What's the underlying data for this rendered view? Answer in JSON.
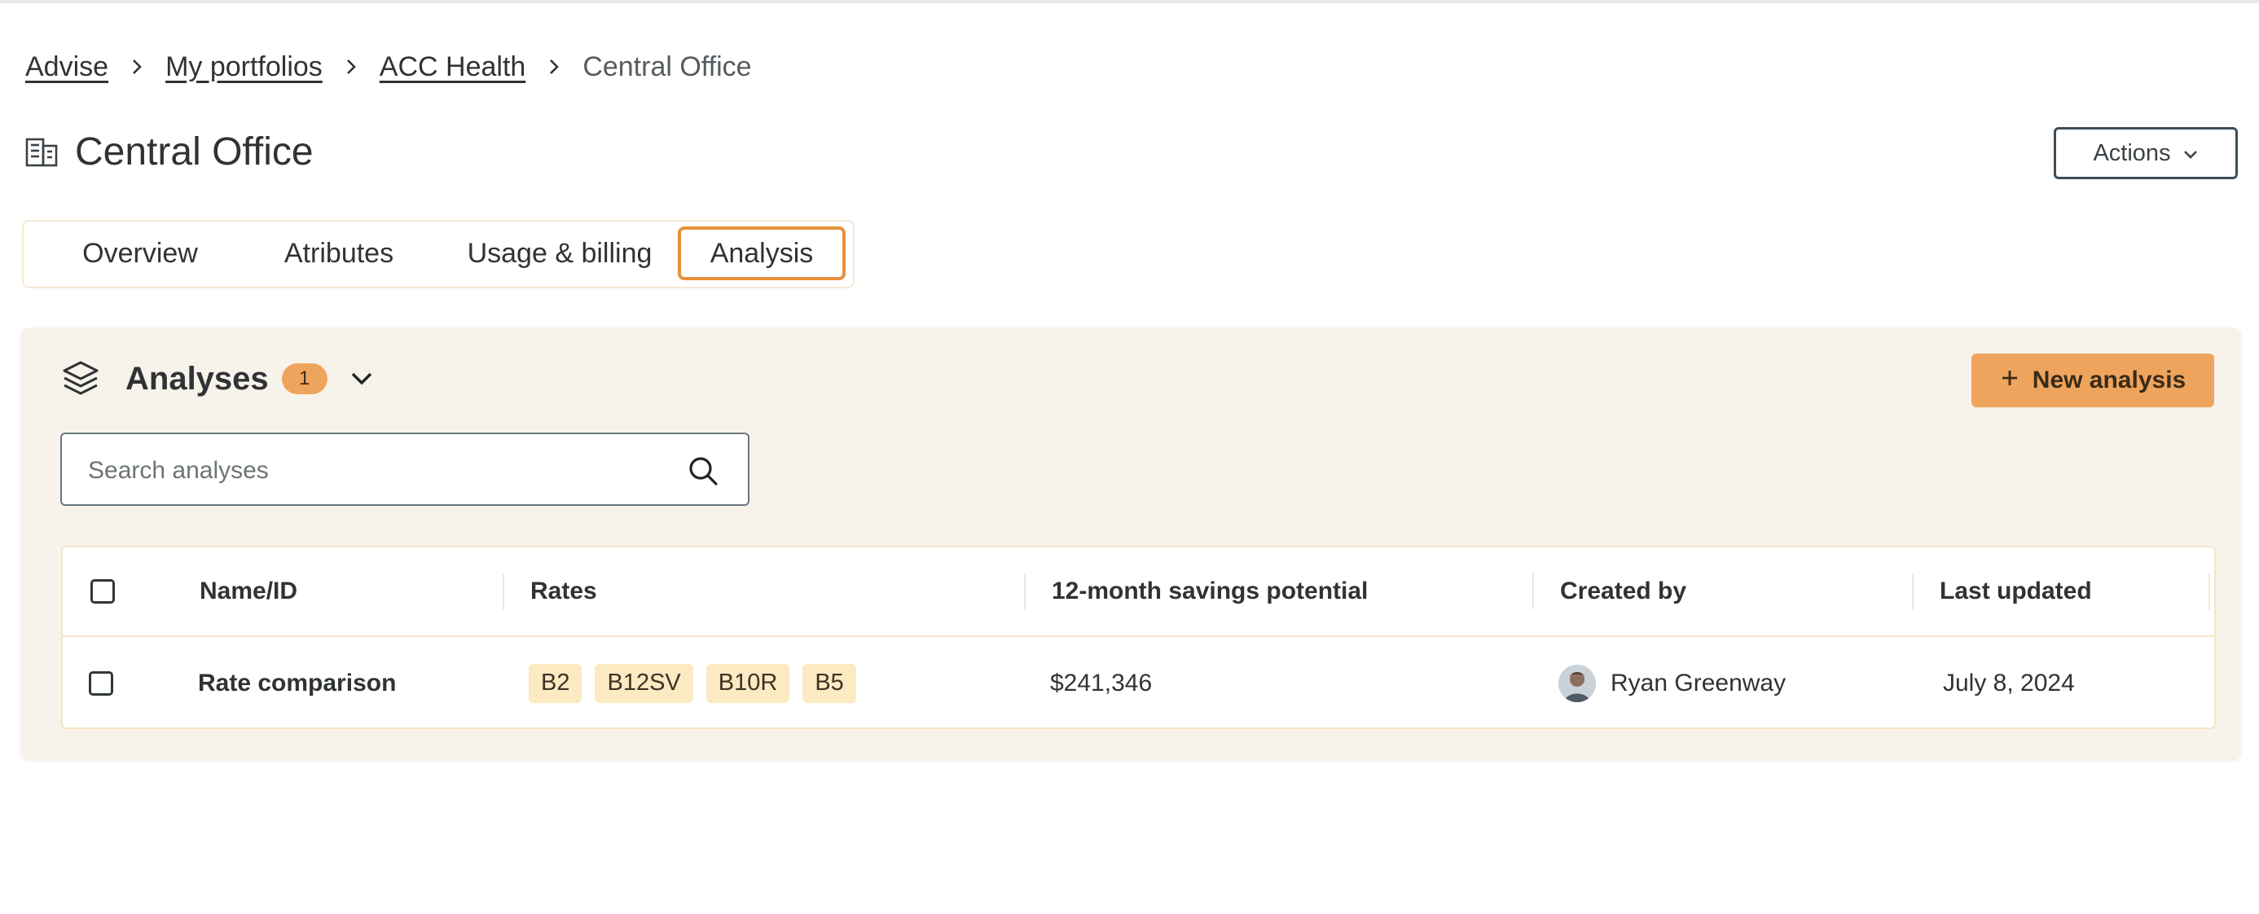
{
  "breadcrumb": {
    "items": [
      "Advise",
      "My portfolios",
      "ACC Health"
    ],
    "current": "Central Office"
  },
  "page": {
    "title": "Central Office",
    "icon": "building-icon"
  },
  "header": {
    "actions_label": "Actions"
  },
  "tabs": [
    {
      "label": "Overview"
    },
    {
      "label": "Atributes"
    },
    {
      "label": "Usage & billing"
    },
    {
      "label": "Analysis",
      "active": true
    }
  ],
  "analyses": {
    "title": "Analyses",
    "count": "1",
    "new_button_label": "New analysis",
    "search": {
      "placeholder": "Search analyses",
      "value": ""
    },
    "columns": [
      "Name/ID",
      "Rates",
      "12-month savings potential",
      "Created by",
      "Last updated"
    ],
    "rows": [
      {
        "name": "Rate comparison",
        "rates": [
          "B2",
          "B12SV",
          "B10R",
          "B5"
        ],
        "savings": "$241,346",
        "created_by": "Ryan Greenway",
        "last_updated": "July 8, 2024"
      }
    ]
  },
  "colors": {
    "accent": "#efa45d",
    "active_tab_border": "#e8913a",
    "panel_bg": "#f8f3ea",
    "rate_tag_bg": "#fbeac2",
    "text": "#2f3336"
  }
}
